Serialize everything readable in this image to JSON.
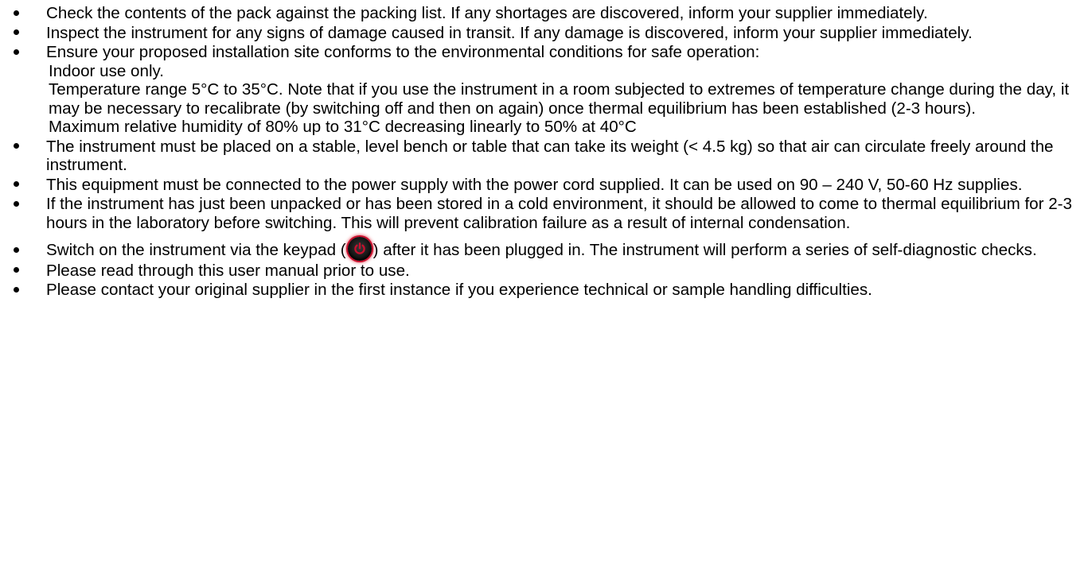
{
  "document": {
    "items": [
      {
        "text": "Check the contents of the pack against the packing list. If any shortages are discovered, inform your supplier immediately."
      },
      {
        "text": "Inspect the instrument for any signs of damage caused in transit.  If any damage is discovered, inform your supplier immediately."
      },
      {
        "text": "Ensure your proposed installation site conforms to the environmental conditions for safe operation:",
        "sub_lines": [
          "Indoor use only.",
          "Temperature range 5°C to 35°C.  Note that if you use the instrument in a room subjected to extremes of temperature change during the day, it may be necessary to recalibrate (by switching off and then on again) once thermal equilibrium has been established (2-3 hours).",
          "Maximum relative humidity of 80% up to 31°C decreasing linearly to 50% at 40°C"
        ]
      },
      {
        "text": "The instrument must be placed on a stable, level bench or table that can take its weight (< 4.5 kg) so that air can circulate freely around the instrument."
      },
      {
        "text": "This equipment must be connected to the power supply with the power cord supplied.  It can be used on 90 – 240 V, 50-60 Hz supplies."
      },
      {
        "text": "If the instrument has just been unpacked or has been stored in a cold environment, it should be allowed to come to thermal equilibrium for 2-3 hours in the laboratory before switching. This will prevent calibration failure as a result of internal condensation."
      },
      {
        "text_before_icon": "Switch on the instrument via the keypad (",
        "icon": "power-button-icon",
        "text_after_icon": ") after it has been plugged in.  The instrument will perform a series of self-diagnostic checks."
      },
      {
        "text": "Please read through this user manual prior to use."
      },
      {
        "text": "Please contact your original supplier in the first instance if you experience technical or sample handling difficulties."
      }
    ]
  },
  "colors": {
    "text": "#000000",
    "background": "#ffffff",
    "power_icon_glow": "#c8102e"
  }
}
